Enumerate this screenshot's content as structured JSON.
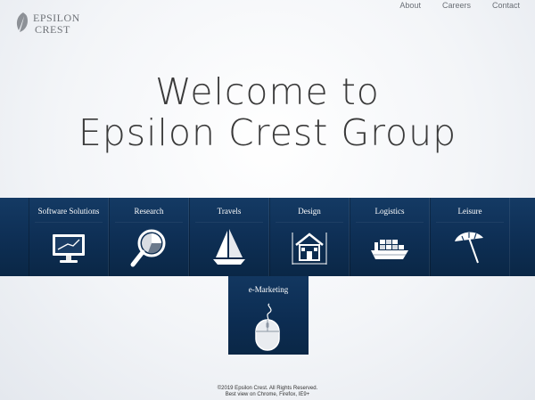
{
  "logo": {
    "line1": "EPSILON",
    "line2": "CREST"
  },
  "nav": {
    "about": "About",
    "careers": "Careers",
    "contact": "Contact"
  },
  "headline": {
    "line1": "Welcome to",
    "line2": "Epsilon Crest Group"
  },
  "tiles": [
    {
      "label": "Software Solutions",
      "icon": "monitor-icon"
    },
    {
      "label": "Research",
      "icon": "magnifier-chart-icon"
    },
    {
      "label": "Travels",
      "icon": "sailboat-icon"
    },
    {
      "label": "Design",
      "icon": "house-blueprint-icon"
    },
    {
      "label": "Logistics",
      "icon": "cargo-ship-icon"
    },
    {
      "label": "Leisure",
      "icon": "beach-umbrella-icon"
    }
  ],
  "extra_tile": {
    "label": "e-Marketing",
    "icon": "mouse-icon"
  },
  "footer": {
    "copyright": "©2019 Epsilon Crest. All Rights Reserved.",
    "browser_note": "Best view on Chrome, Firefox, IE9+"
  },
  "colors": {
    "tile_background": "#0e2f55",
    "text_dark": "#3a3a3a"
  }
}
